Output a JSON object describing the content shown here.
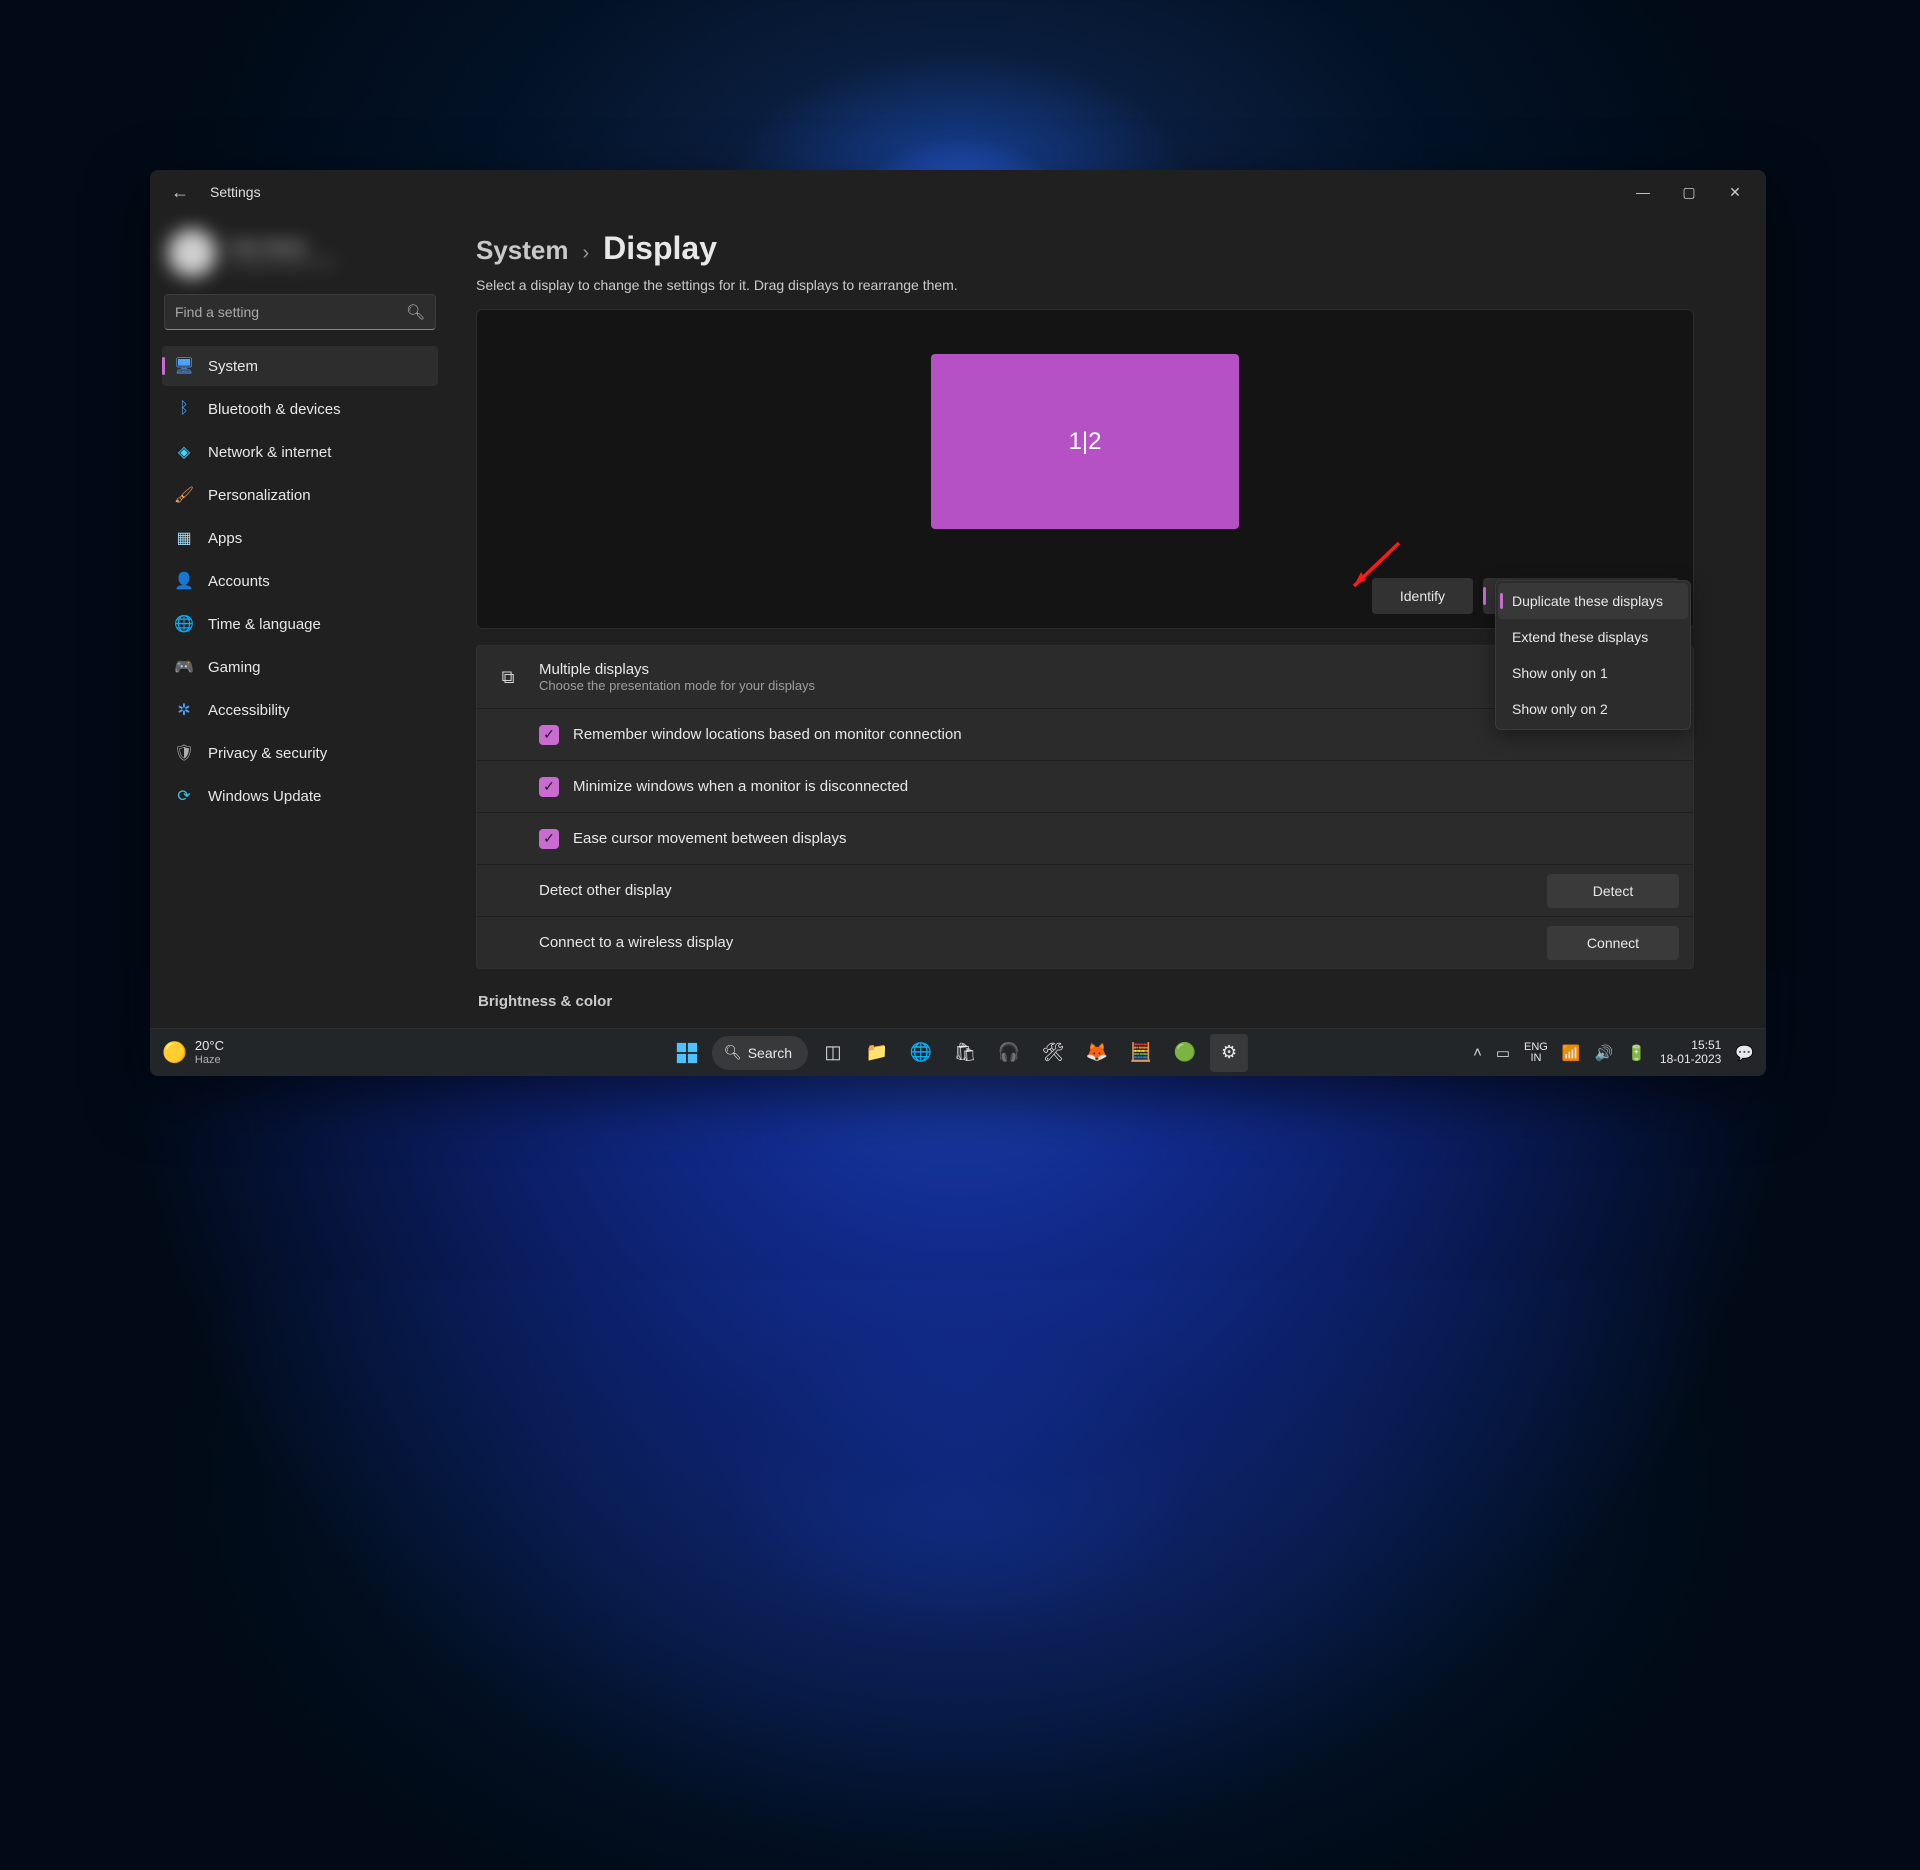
{
  "window": {
    "app_title": "Settings",
    "min": "—",
    "max": "▢",
    "close": "✕",
    "back": "←"
  },
  "user": {
    "name": "User Name",
    "email": "user@example.com"
  },
  "search": {
    "placeholder": "Find a setting"
  },
  "nav": {
    "system": "System",
    "bluetooth": "Bluetooth & devices",
    "network": "Network & internet",
    "personalization": "Personalization",
    "apps": "Apps",
    "accounts": "Accounts",
    "time": "Time & language",
    "gaming": "Gaming",
    "accessibility": "Accessibility",
    "privacy": "Privacy & security",
    "update": "Windows Update"
  },
  "breadcrumb": {
    "parent": "System",
    "sep": "›",
    "current": "Display"
  },
  "subtitle": "Select a display to change the settings for it. Drag displays to rearrange them.",
  "monitor_label": "1|2",
  "identify_btn": "Identify",
  "multi_dd": {
    "selected": "Duplicate these displays",
    "options": {
      "dup": "Duplicate these displays",
      "ext": "Extend these displays",
      "only1": "Show only on 1",
      "only2": "Show only on 2"
    }
  },
  "multi_section": {
    "title": "Multiple displays",
    "sub": "Choose the presentation mode for your displays",
    "remember": "Remember window locations based on monitor connection",
    "minimize": "Minimize windows when a monitor is disconnected",
    "ease": "Ease cursor movement between displays",
    "detect_row": "Detect other display",
    "detect_btn": "Detect",
    "wireless_row": "Connect to a wireless display",
    "connect_btn": "Connect"
  },
  "brightness_header": "Brightness & color",
  "taskbar": {
    "weather_temp": "20°C",
    "weather_cond": "Haze",
    "search_label": "Search",
    "lang1": "ENG",
    "lang2": "IN",
    "time": "15:51",
    "date": "18-01-2023"
  }
}
